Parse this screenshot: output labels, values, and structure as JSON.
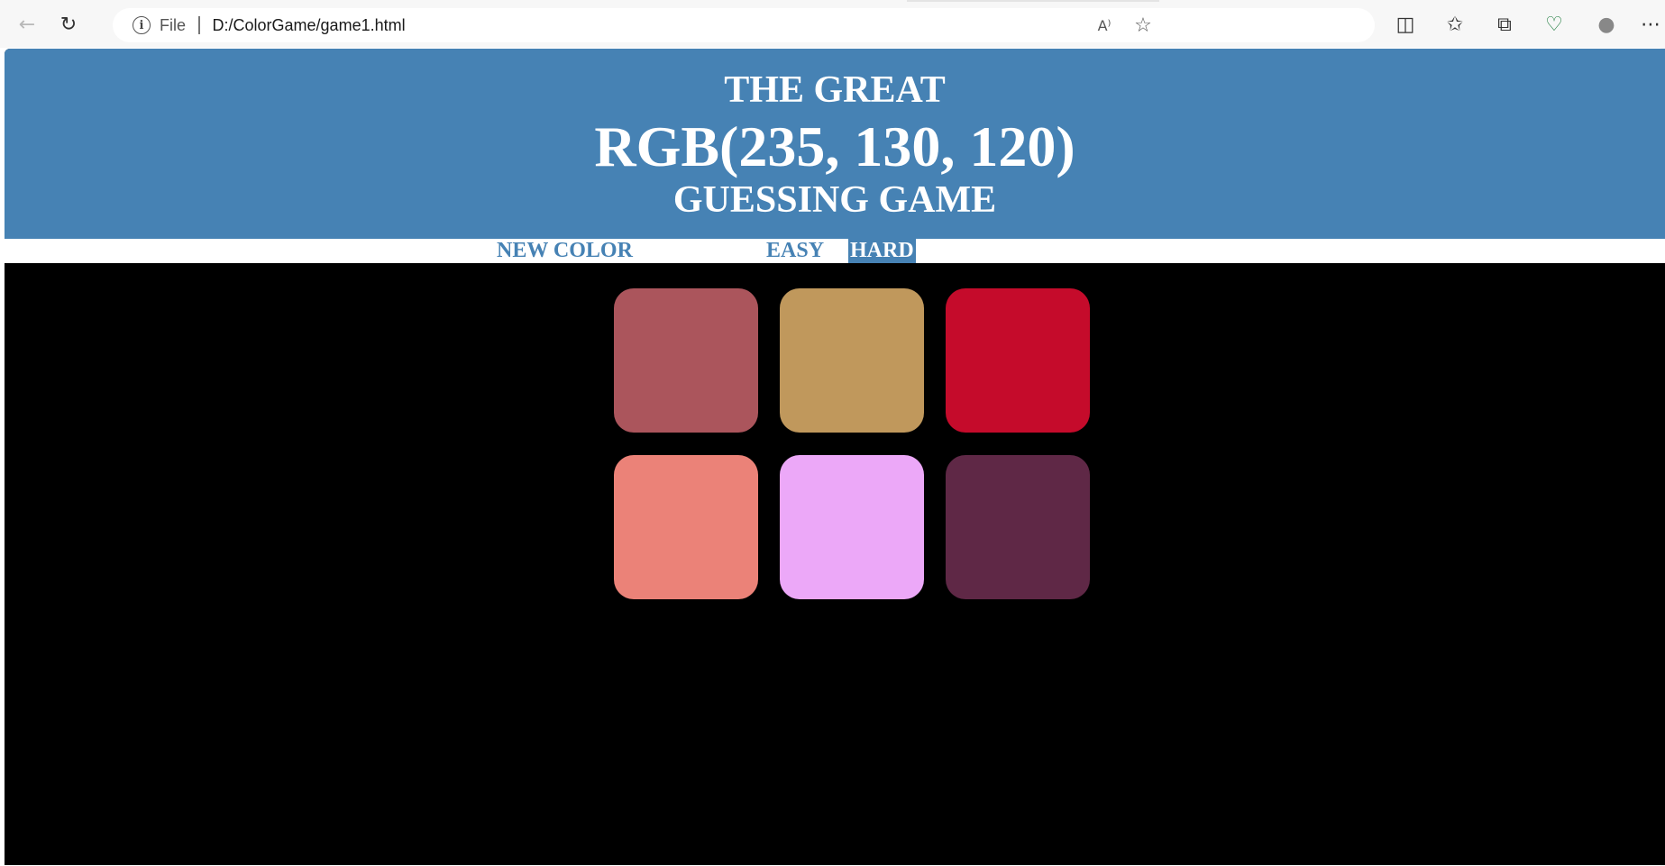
{
  "browser": {
    "back_icon": "←",
    "reload_icon": "↻",
    "info_icon": "i",
    "file_label": "File",
    "url": "D:/ColorGame/game1.html",
    "read_aloud_icon": "A⁾",
    "favorite_icon": "☆",
    "split_icon": "◫",
    "favorites_icon": "✩",
    "collections_icon": "⧉",
    "health_icon": "♡",
    "profile_icon": "●",
    "more_icon": "⋯"
  },
  "header": {
    "line1": "THE GREAT",
    "rgb": "RGB(235, 130, 120)",
    "line3": "GUESSING GAME",
    "background": "#4682b4"
  },
  "controls": {
    "new_color": "NEW COLOR",
    "easy": "EASY",
    "hard": "HARD",
    "selected": "HARD"
  },
  "squares": [
    {
      "color": "#ab555c"
    },
    {
      "color": "#c0985c"
    },
    {
      "color": "#c50b2b"
    },
    {
      "color": "#eb8278"
    },
    {
      "color": "#eca8f8"
    },
    {
      "color": "#5f2846"
    }
  ]
}
